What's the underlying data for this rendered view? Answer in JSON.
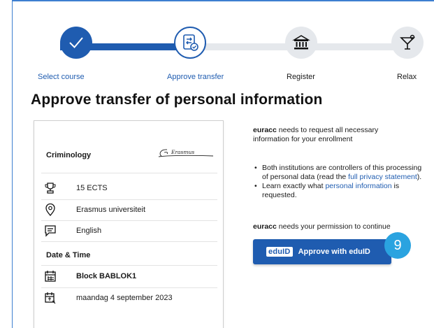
{
  "steps": [
    {
      "label": "Select course",
      "icon": "checkmark-icon",
      "state": "done"
    },
    {
      "label": "Approve transfer",
      "icon": "document-transfer-icon",
      "state": "active"
    },
    {
      "label": "Register",
      "icon": "institution-building-icon",
      "state": "todo"
    },
    {
      "label": "Relax",
      "icon": "cocktail-glass-icon",
      "state": "todo"
    }
  ],
  "page": {
    "title": "Approve transfer of personal information"
  },
  "course": {
    "name": "Criminology",
    "logo_text": "Erasmus",
    "credits": "15 ECTS",
    "institution": "Erasmus universiteit",
    "language": "English",
    "datetime_heading": "Date & Time",
    "block": "Block BABLOK1",
    "date": "maandag 4 september 2023"
  },
  "info": {
    "org": "euracc",
    "intro_rest": " needs to request all necessary information for your enrollment",
    "bullet1_pre": "Both institutions are controllers of this processing of personal data (read the ",
    "bullet1_link": "full privacy statement",
    "bullet1_post": ").",
    "bullet2_pre": "Learn exactly what ",
    "bullet2_link": "personal information",
    "bullet2_post": " is requested.",
    "permission_rest": " needs your permission to continue"
  },
  "approve": {
    "logo": "eduID",
    "label": "Approve with eduID"
  },
  "badge": {
    "number": "9"
  },
  "colors": {
    "primary": "#1f5cb0",
    "track_inactive": "#e5e8ec",
    "badge": "#2aa3e0"
  }
}
